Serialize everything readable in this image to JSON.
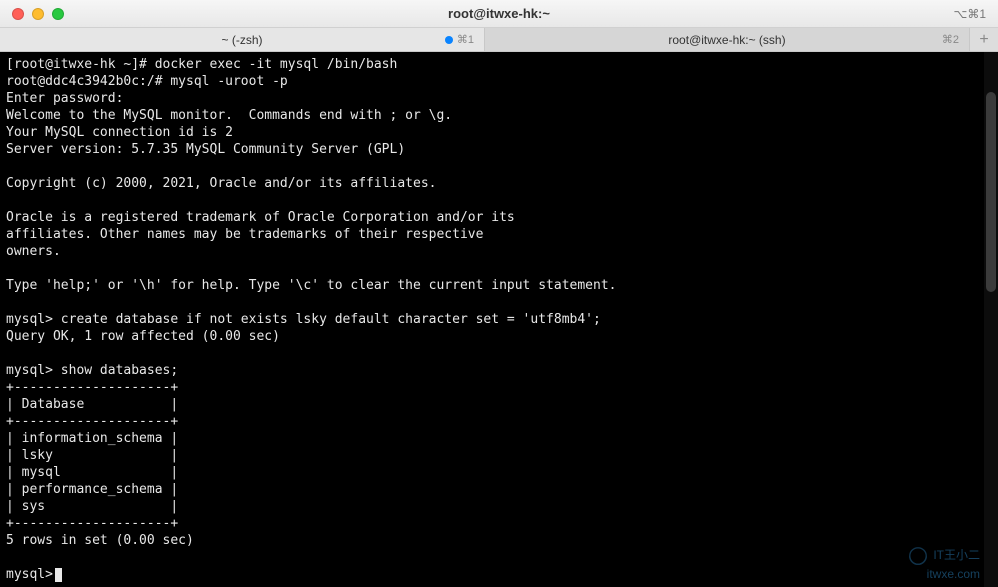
{
  "window": {
    "title": "root@itwxe-hk:~",
    "shortcut": "⌥⌘1"
  },
  "tabs": [
    {
      "label": "~ (-zsh)",
      "shortcut": "⌘1",
      "has_dot": true
    },
    {
      "label": "root@itwxe-hk:~ (ssh)",
      "shortcut": "⌘2",
      "has_dot": false
    }
  ],
  "add_tab": "+",
  "terminal_lines": [
    "[root@itwxe-hk ~]# docker exec -it mysql /bin/bash",
    "root@ddc4c3942b0c:/# mysql -uroot -p",
    "Enter password:",
    "Welcome to the MySQL monitor.  Commands end with ; or \\g.",
    "Your MySQL connection id is 2",
    "Server version: 5.7.35 MySQL Community Server (GPL)",
    "",
    "Copyright (c) 2000, 2021, Oracle and/or its affiliates.",
    "",
    "Oracle is a registered trademark of Oracle Corporation and/or its",
    "affiliates. Other names may be trademarks of their respective",
    "owners.",
    "",
    "Type 'help;' or '\\h' for help. Type '\\c' to clear the current input statement.",
    "",
    "mysql> create database if not exists lsky default character set = 'utf8mb4';",
    "Query OK, 1 row affected (0.00 sec)",
    "",
    "mysql> show databases;",
    "+--------------------+",
    "| Database           |",
    "+--------------------+",
    "| information_schema |",
    "| lsky               |",
    "| mysql              |",
    "| performance_schema |",
    "| sys                |",
    "+--------------------+",
    "5 rows in set (0.00 sec)",
    "",
    "mysql>"
  ],
  "watermark": {
    "line1": "IT王小二",
    "line2": "itwxe.com"
  }
}
